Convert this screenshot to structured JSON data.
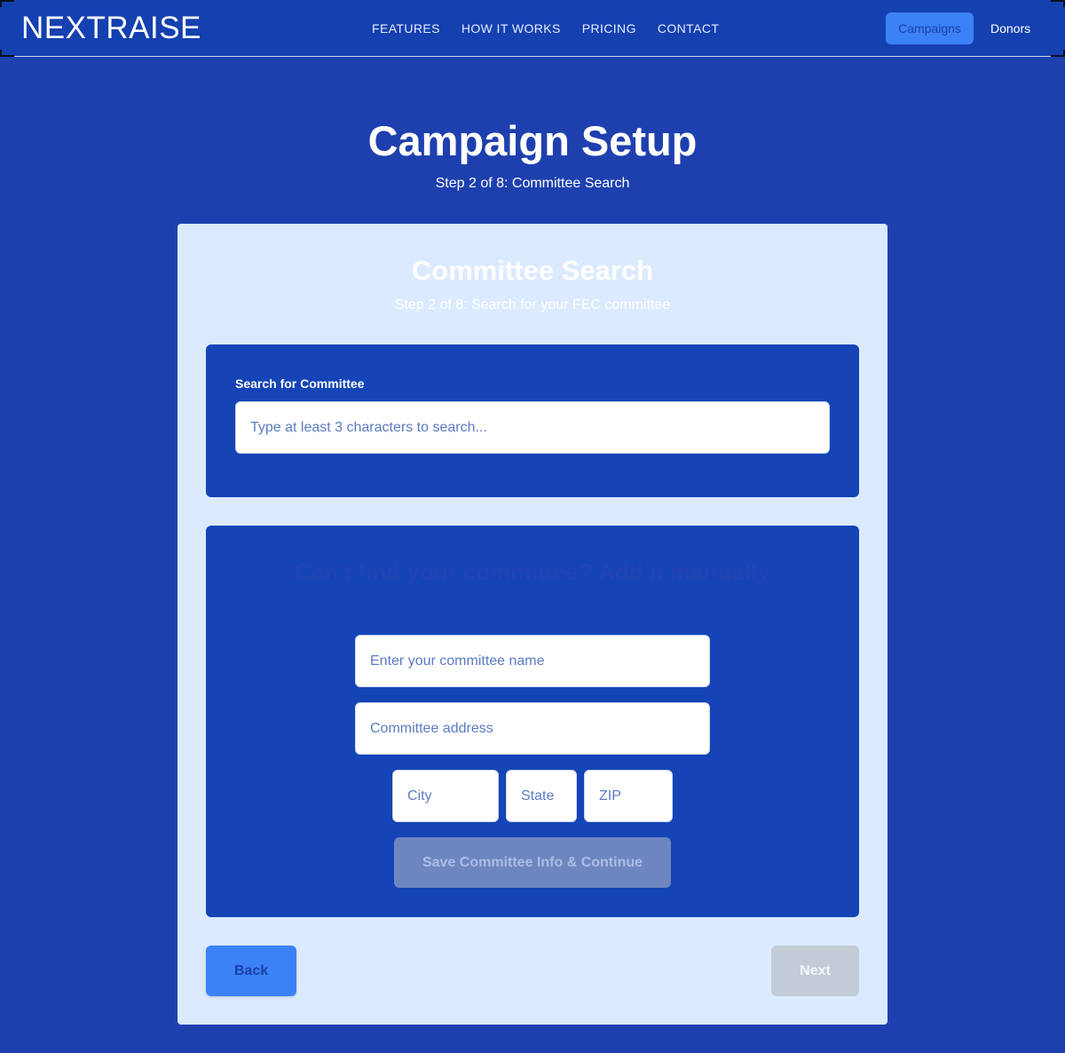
{
  "nav": {
    "brand": "NEXTRAISE",
    "links": [
      "FEATURES",
      "HOW IT WORKS",
      "PRICING",
      "CONTACT"
    ],
    "campaigns_label": "Campaigns",
    "donors_label": "Donors"
  },
  "header": {
    "title": "Campaign Setup",
    "subtitle": "Step 2 of 8: Committee Search"
  },
  "card": {
    "title": "Committee Search",
    "subtitle": "Step 2 of 8: Search for your FEC committee"
  },
  "search": {
    "label": "Search for Committee",
    "placeholder": "Type at least 3 characters to search..."
  },
  "manual": {
    "heading": "Can't find your committee? Add it manually",
    "subheading": "",
    "name_placeholder": "Enter your committee name",
    "address_placeholder": "Committee address",
    "city_placeholder": "City",
    "state_placeholder": "State",
    "zip_placeholder": "ZIP",
    "save_label": "Save Committee Info & Continue"
  },
  "footer_buttons": {
    "back_label": "Back",
    "next_label": "Next"
  }
}
